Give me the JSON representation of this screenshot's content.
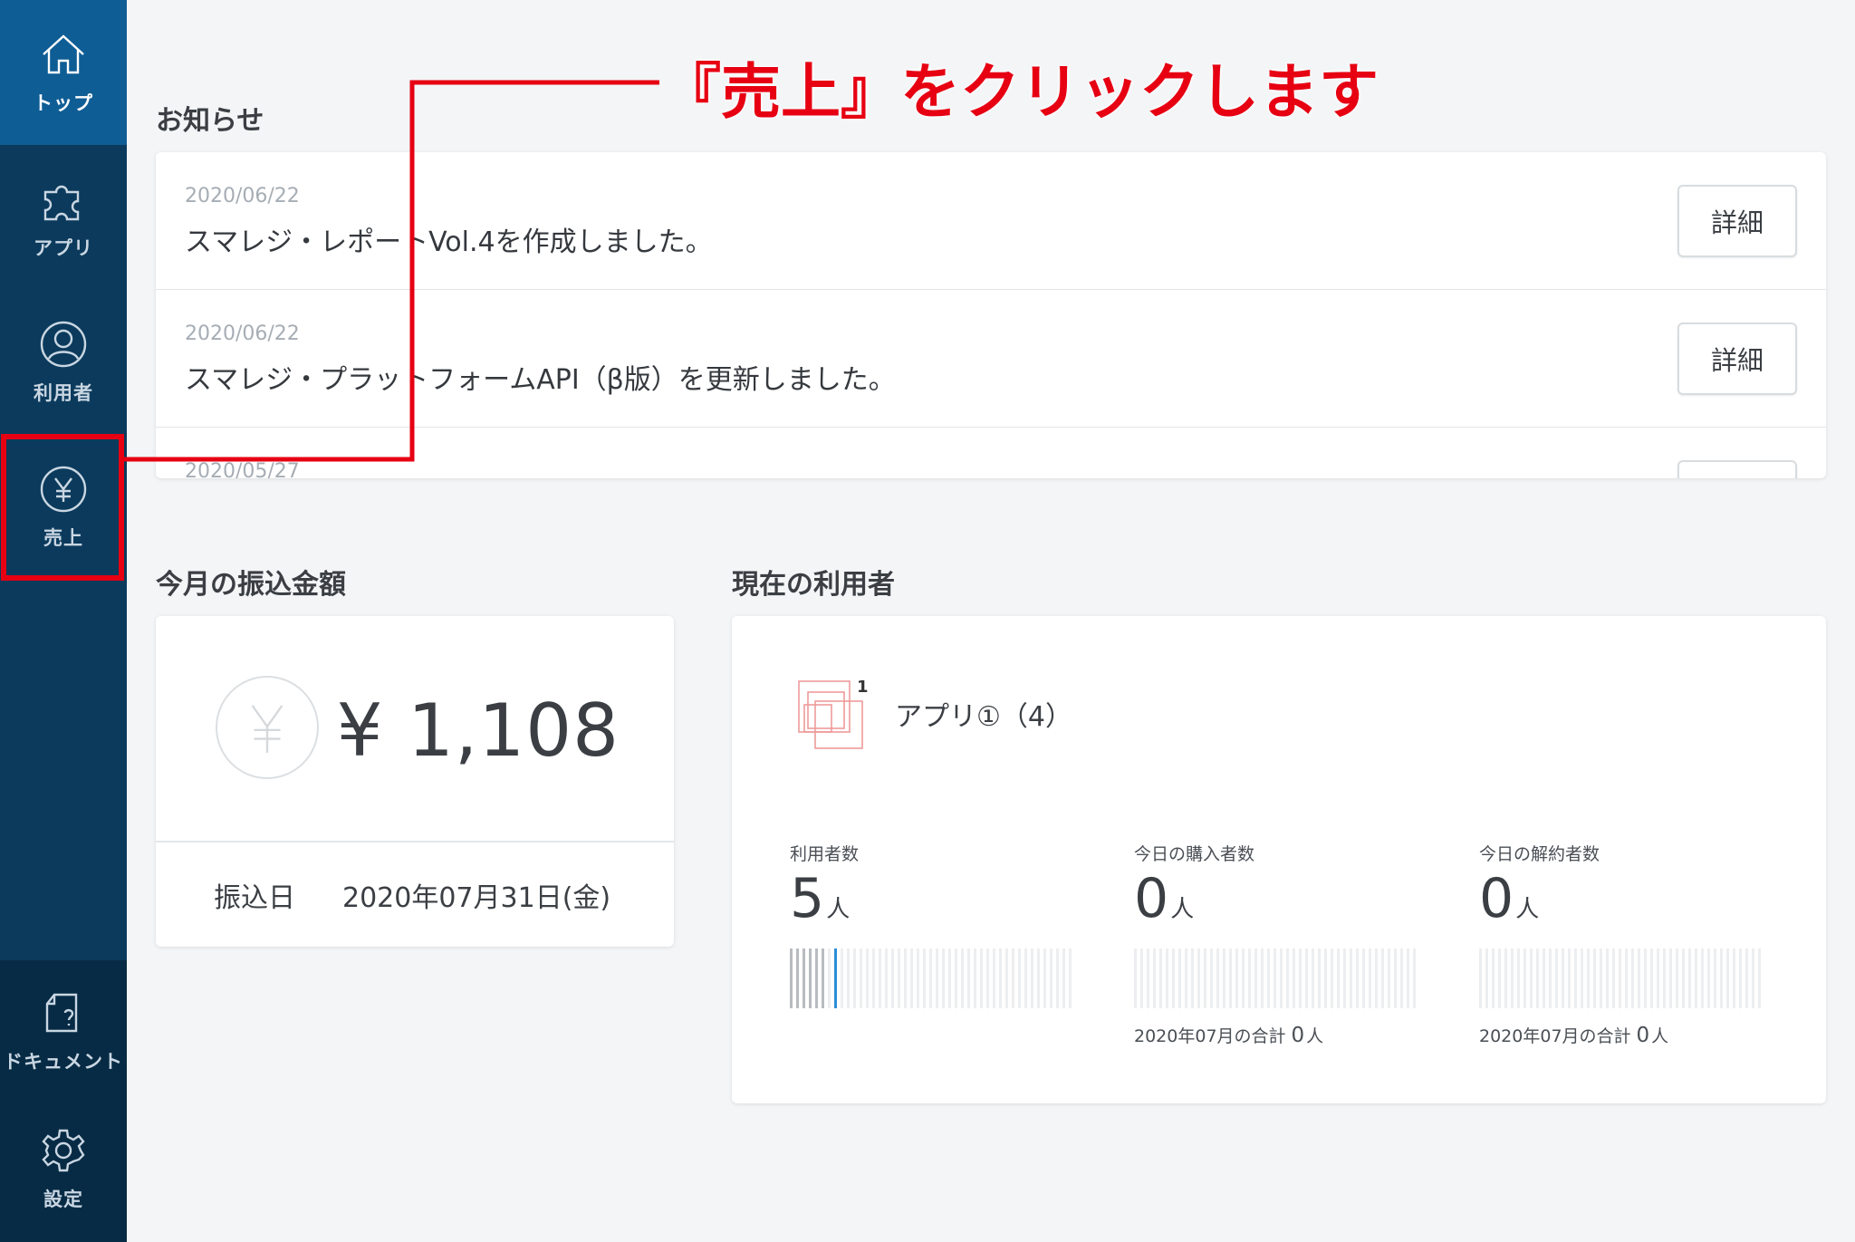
{
  "sidebar": {
    "items": [
      {
        "label": "トップ",
        "icon": "home-icon"
      },
      {
        "label": "アプリ",
        "icon": "puzzle-icon"
      },
      {
        "label": "利用者",
        "icon": "user-icon"
      },
      {
        "label": "売上",
        "icon": "yen-icon"
      }
    ],
    "bottom": [
      {
        "label": "ドキュメント",
        "icon": "document-help-icon"
      },
      {
        "label": "設定",
        "icon": "gear-icon"
      }
    ]
  },
  "notices": {
    "title": "お知らせ",
    "items": [
      {
        "date": "2020/06/22",
        "text": "スマレジ・レポートVol.4を作成しました。",
        "button": "詳細"
      },
      {
        "date": "2020/06/22",
        "text": "スマレジ・プラットフォームAPI（β版）を更新しました。",
        "button": "詳細"
      },
      {
        "date": "2020/05/27",
        "text": "",
        "button": ""
      }
    ]
  },
  "transfer": {
    "title": "今月の振込金額",
    "amount": "¥ 1,108",
    "date_label": "振込日",
    "date": "2020年07月31日(金)"
  },
  "current_users": {
    "title": "現在の利用者",
    "app_badge": "1",
    "app_name": "アプリ①（4）",
    "stats": [
      {
        "label": "利用者数",
        "value": "5",
        "unit": "人",
        "total_label": "",
        "total_value": "",
        "total_unit": ""
      },
      {
        "label": "今日の購入者数",
        "value": "0",
        "unit": "人",
        "total_label": "2020年07月の合計",
        "total_value": "0",
        "total_unit": "人"
      },
      {
        "label": "今日の解約者数",
        "value": "0",
        "unit": "人",
        "total_label": "2020年07月の合計",
        "total_value": "0",
        "total_unit": "人"
      }
    ]
  },
  "annotation": {
    "text": "『売上』をクリックします",
    "color": "#e60012"
  },
  "colors": {
    "sidebar": "#0b3a5c",
    "sidebar_active": "#0f5d95",
    "accent": "#2b8ed8"
  }
}
